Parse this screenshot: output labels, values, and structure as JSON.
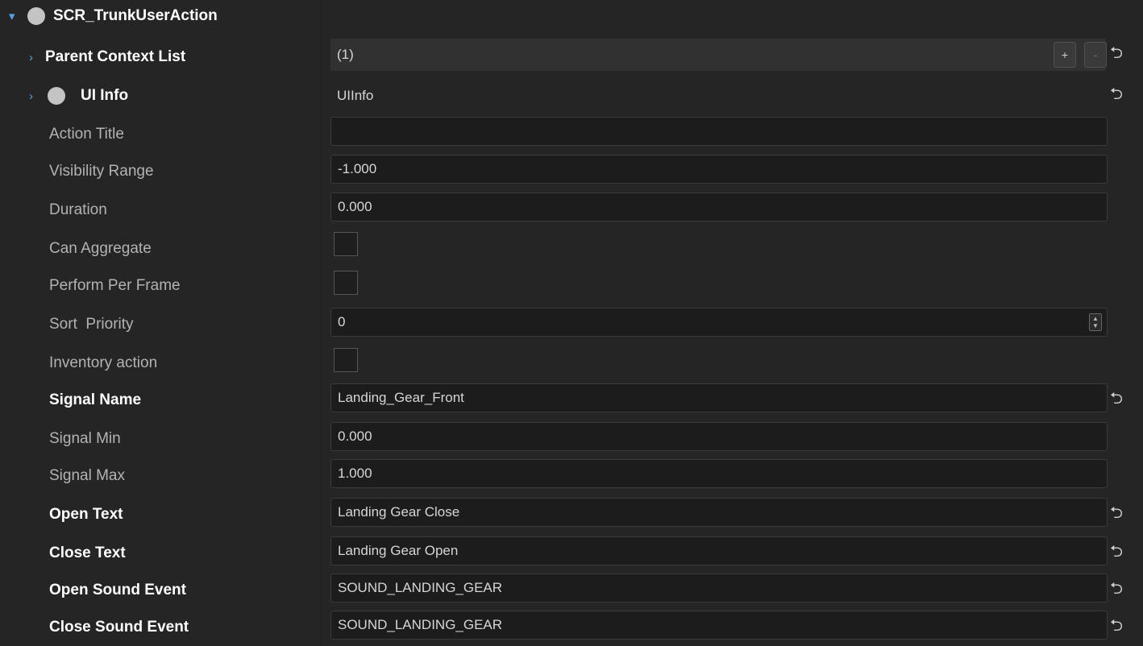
{
  "component": {
    "name": "SCR_TrunkUserAction"
  },
  "properties": {
    "parent_context_list": {
      "label": "Parent Context List",
      "value": "(1)",
      "add_label": "+",
      "remove_label": "-"
    },
    "ui_info": {
      "label": "UI Info",
      "value": "UIInfo"
    },
    "action_title": {
      "label": "Action Title",
      "value": ""
    },
    "visibility_range": {
      "label": "Visibility Range",
      "value": "-1.000"
    },
    "duration": {
      "label": "Duration",
      "value": "0.000"
    },
    "can_aggregate": {
      "label": "Can Aggregate",
      "checked": false
    },
    "perform_per_frame": {
      "label": "Perform Per Frame",
      "checked": false
    },
    "sort_priority": {
      "label": "Sort  Priority",
      "value": "0"
    },
    "inventory_action": {
      "label": "Inventory action",
      "checked": false
    },
    "signal_name": {
      "label": "Signal Name",
      "value": "Landing_Gear_Front"
    },
    "signal_min": {
      "label": "Signal Min",
      "value": "0.000"
    },
    "signal_max": {
      "label": "Signal Max",
      "value": "1.000"
    },
    "open_text": {
      "label": "Open Text",
      "value": "Landing Gear Close"
    },
    "close_text": {
      "label": "Close Text",
      "value": "Landing Gear Open"
    },
    "open_sound_event": {
      "label": "Open Sound Event",
      "value": "SOUND_LANDING_GEAR"
    },
    "close_sound_event": {
      "label": "Close Sound Event",
      "value": "SOUND_LANDING_GEAR"
    }
  },
  "icons": {
    "reset": "reset-icon",
    "expand": "expand-arrow-icon",
    "collapse": "collapse-arrow-icon",
    "object": "object-circle-icon"
  },
  "colors": {
    "background": "#252525",
    "field": "#1c1c1c",
    "accent_arrow": "#5aa0e6",
    "modified_label": "#ffffff",
    "default_label": "#b3b3b3"
  }
}
